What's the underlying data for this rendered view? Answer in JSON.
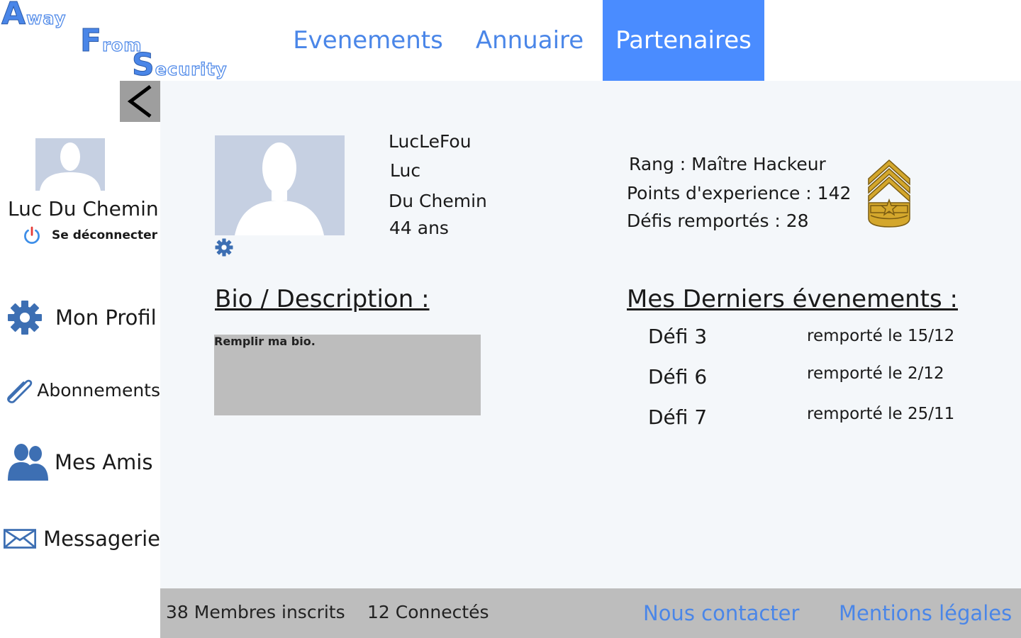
{
  "logo": {
    "word1_initial": "A",
    "word1_rest": "way",
    "word2_initial": "F",
    "word2_rest": "rom",
    "word3_initial": "S",
    "word3_rest": "ecurity"
  },
  "nav": {
    "items": [
      {
        "label": "Evenements"
      },
      {
        "label": "Annuaire"
      },
      {
        "label": "Partenaires"
      }
    ],
    "active_color": "#4a8cff"
  },
  "sidebar": {
    "user_name": "Luc Du Chemin",
    "logout_label": "Se déconnecter",
    "items": [
      {
        "label": "Mon Profil",
        "icon": "gear-icon"
      },
      {
        "label": "Abonnements",
        "icon": "paperclip-icon"
      },
      {
        "label": "Mes Amis",
        "icon": "users-icon"
      },
      {
        "label": "Messagerie",
        "icon": "envelope-icon"
      }
    ]
  },
  "profile": {
    "username": "LucLeFou",
    "first_name": "Luc",
    "last_name": "Du Chemin",
    "age": "44 ans",
    "rank": "Rang : Maître Hackeur",
    "xp": "Points d'experience : 142",
    "challenges": "Défis remportés : 28"
  },
  "bio": {
    "heading": "Bio / Description :",
    "placeholder": "Remplir ma bio."
  },
  "events": {
    "heading": "Mes Derniers évenements :",
    "items": [
      {
        "name": "Défi 3",
        "status": "remporté le 15/12"
      },
      {
        "name": "Défi 6",
        "status": "remporté le 2/12"
      },
      {
        "name": "Défi 7",
        "status": "remporté le 25/11"
      }
    ]
  },
  "footer": {
    "members": "38 Membres inscrits",
    "connected": "12 Connectés",
    "contact": "Nous contacter",
    "legal": "Mentions légales"
  },
  "colors": {
    "accent": "#4a86e8",
    "content_bg": "#f4f7fa",
    "footer_bg": "#bdbdbd",
    "bio_bg": "#bdbdbd",
    "avatar_bg": "#c6d0e2",
    "icon_blue": "#3d6fb3",
    "badge_gold": "#d4a72c"
  }
}
